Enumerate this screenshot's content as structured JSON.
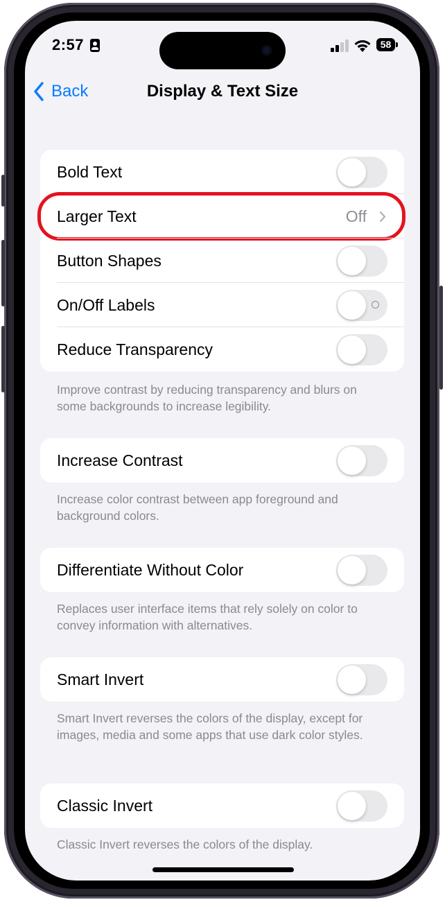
{
  "status": {
    "time": "2:57",
    "battery": "58"
  },
  "nav": {
    "back_label": "Back",
    "title": "Display & Text Size"
  },
  "group1": {
    "rows": [
      {
        "label": "Bold Text",
        "control": "toggle",
        "on": false
      },
      {
        "label": "Larger Text",
        "control": "disclosure",
        "value": "Off"
      },
      {
        "label": "Button Shapes",
        "control": "toggle",
        "on": false
      },
      {
        "label": "On/Off Labels",
        "control": "toggle",
        "on": false
      },
      {
        "label": "Reduce Transparency",
        "control": "toggle",
        "on": false
      }
    ],
    "footer": "Improve contrast by reducing transparency and blurs on some backgrounds to increase legibility."
  },
  "group2": {
    "label": "Increase Contrast",
    "footer": "Increase color contrast between app foreground and background colors."
  },
  "group3": {
    "label": "Differentiate Without Color",
    "footer": "Replaces user interface items that rely solely on color to convey information with alternatives."
  },
  "group4": {
    "label": "Smart Invert",
    "footer": "Smart Invert reverses the colors of the display, except for images, media and some apps that use dark color styles."
  },
  "group5": {
    "label": "Classic Invert",
    "footer": "Classic Invert reverses the colors of the display."
  },
  "colors": {
    "accent": "#0a7aff",
    "background": "#f2f2f7",
    "toggle_off": "#e9e9eb",
    "highlight": "#e3131f",
    "secondary_text": "#8a8a8e"
  }
}
